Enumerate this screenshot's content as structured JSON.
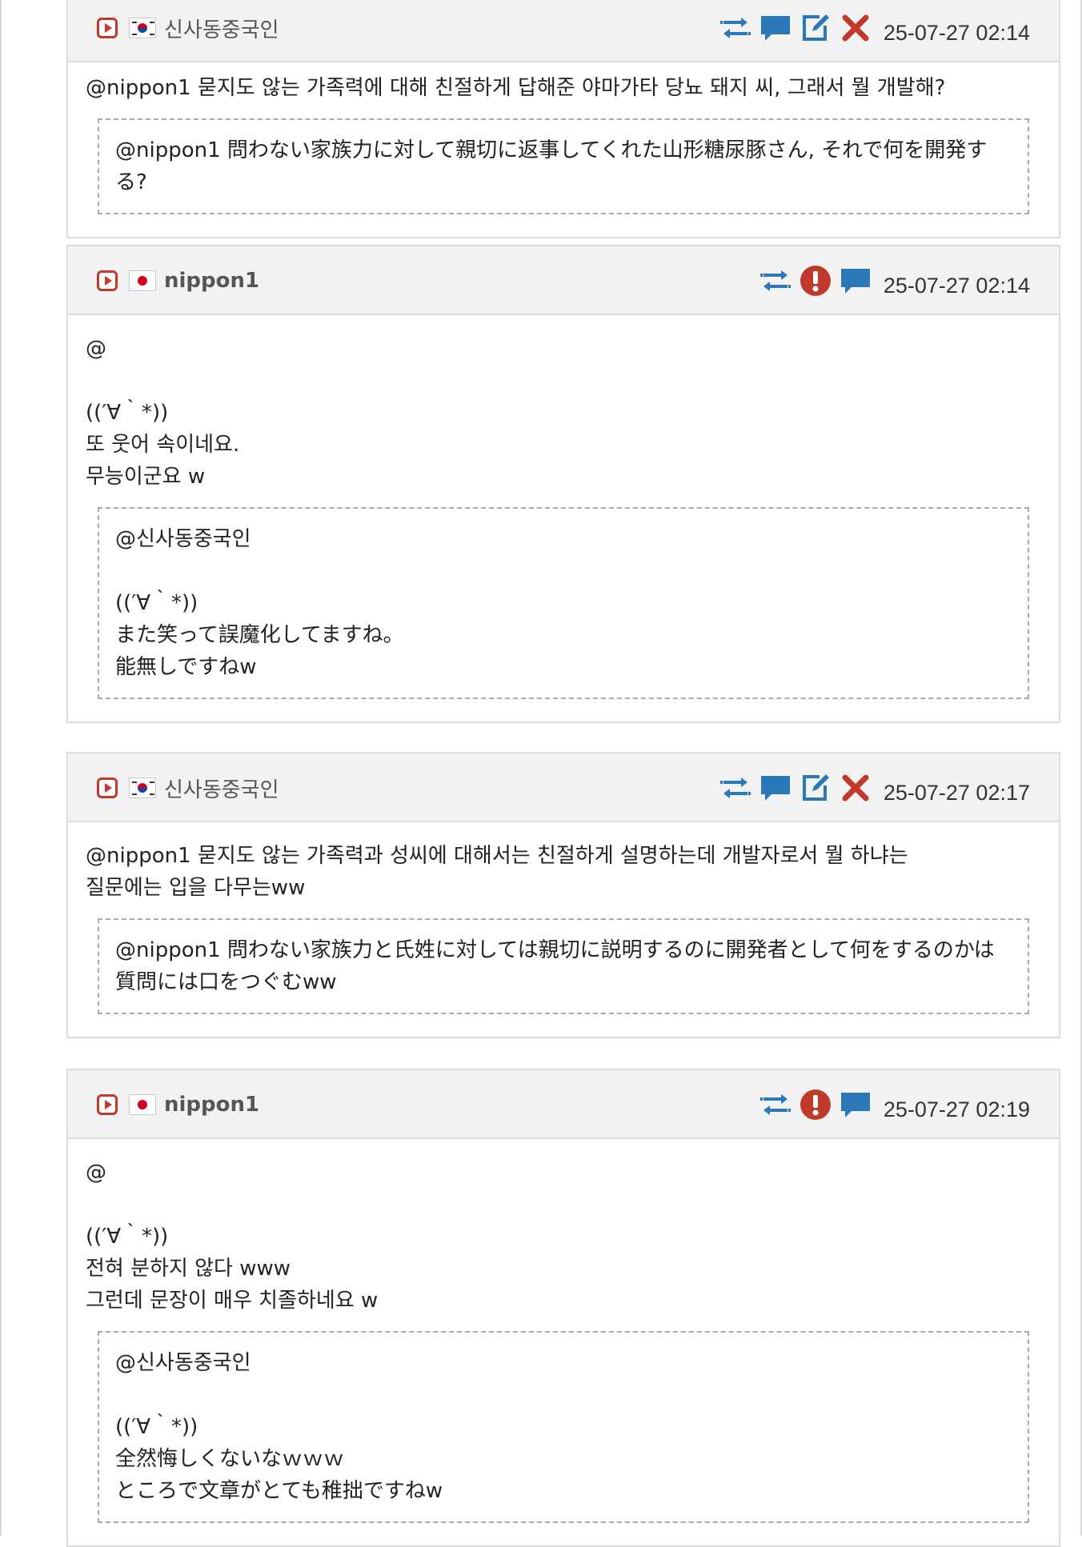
{
  "posts": [
    {
      "username": "신사동중국인",
      "flag": "kr",
      "timestamp": "25-07-27 02:14",
      "actions": [
        "share-icon",
        "comment-icon",
        "edit-icon",
        "delete-icon"
      ],
      "lines": [
        "@nippon1 묻지도 않는 가족력에 대해 친절하게 답해준 야마가타 당뇨 돼지 씨, 그래서 뭘 개발해?"
      ],
      "translation": [
        "@nippon1 問わない家族力に対して親切に返事してくれた山形糖尿豚さん, それで何を開発する?"
      ]
    },
    {
      "username": "nippon1",
      "flag": "jp",
      "timestamp": "25-07-27 02:14",
      "actions": [
        "share-icon",
        "report-icon",
        "comment-icon"
      ],
      "lines": [
        "@",
        "",
        "((′∀｀*))",
        "또 웃어 속이네요.",
        "무능이군요 w"
      ],
      "translation": [
        "@신사동중국인",
        "",
        "((′∀｀*))",
        "また笑って誤魔化してますね。",
        "能無しですねw"
      ]
    },
    {
      "username": "신사동중국인",
      "flag": "kr",
      "timestamp": "25-07-27 02:17",
      "actions": [
        "share-icon",
        "comment-icon",
        "edit-icon",
        "delete-icon"
      ],
      "lines": [
        "@nippon1 묻지도 않는 가족력과 성씨에 대해서는 친절하게 설명하는데 개발자로서 뭘 하냐는",
        "질문에는 입을 다무는ww"
      ],
      "translation": [
        "@nippon1 問わない家族力と氏姓に対しては親切に説明するのに開発者として何をするのかは",
        "質問には口をつぐむww"
      ]
    },
    {
      "username": "nippon1",
      "flag": "jp",
      "timestamp": "25-07-27 02:19",
      "actions": [
        "share-icon",
        "report-icon",
        "comment-icon"
      ],
      "lines": [
        "@",
        "",
        "((′∀｀*))",
        "전혀 분하지 않다 www",
        "그런데 문장이 매우 치졸하네요 w"
      ],
      "translation": [
        "@신사동중국인",
        "",
        "((′∀｀*))",
        "全然悔しくないなｗｗｗ",
        "ところで文章がとても稚拙ですねw"
      ]
    }
  ],
  "colors": {
    "accent_blue": "#2a78b8",
    "danger_red": "#c0392b",
    "header_bg": "#f2f2f2"
  }
}
